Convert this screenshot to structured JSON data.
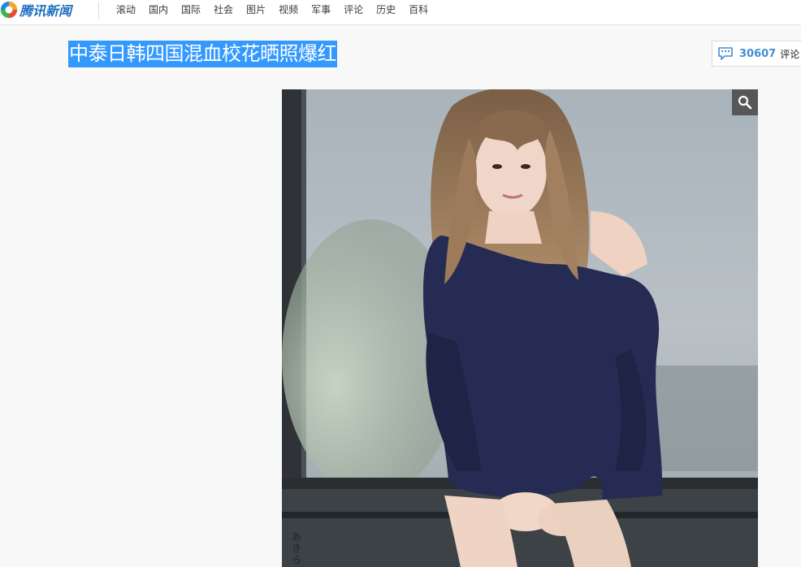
{
  "header": {
    "logo_text": "腾讯新闻",
    "nav": [
      "滚动",
      "国内",
      "国际",
      "社会",
      "图片",
      "视频",
      "军事",
      "评论",
      "历史",
      "百科"
    ]
  },
  "article": {
    "title": "中泰日韩四国混血校花晒照爆红",
    "comment_count": "30607",
    "comment_label": "评论"
  },
  "photo": {
    "watermark": "あきら"
  },
  "icons": {
    "logo": "tencent-logo-icon",
    "comment": "speech-bubble-icon",
    "zoom": "magnifier-icon"
  },
  "colors": {
    "brand_blue": "#1e6fc0",
    "title_highlight": "#3399ff",
    "comment_count": "#3f8fd2"
  }
}
